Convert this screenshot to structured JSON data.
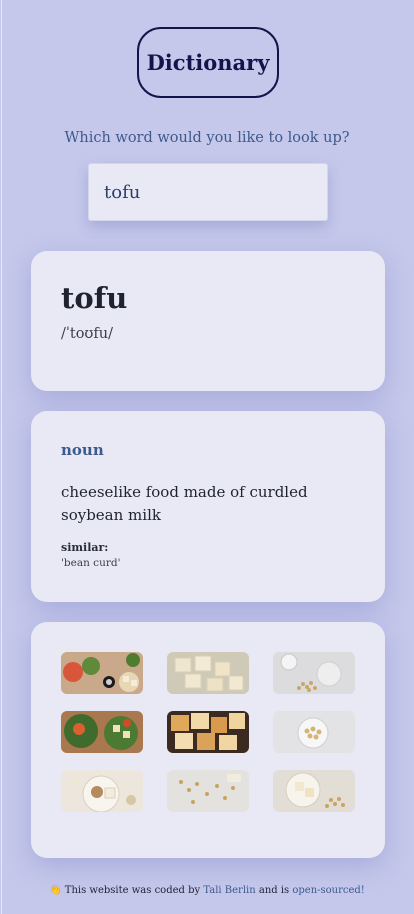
{
  "app": {
    "title": "Dictionary"
  },
  "search": {
    "prompt": "Which word would you like to look up?",
    "value": "tofu"
  },
  "word_card": {
    "word": "tofu",
    "phonetic": "/ˈtoʊfu/"
  },
  "definition_card": {
    "part_of_speech": "noun",
    "definition": "cheeselike food made of curdled soybean milk",
    "similar_label": "similar:",
    "similar_value": "'bean curd'"
  },
  "photos": [
    {
      "name": "photo-tofu-salad-spread",
      "subject": "tofu salad with greens"
    },
    {
      "name": "photo-tofu-cubes",
      "subject": "tofu cubes"
    },
    {
      "name": "photo-soybeans-milk",
      "subject": "soybeans and soy milk"
    },
    {
      "name": "photo-tofu-bowls",
      "subject": "tofu vegetable bowls"
    },
    {
      "name": "photo-fried-tofu",
      "subject": "fried tofu cubes"
    },
    {
      "name": "photo-soybean-bowl",
      "subject": "soybeans in bowl"
    },
    {
      "name": "photo-tofu-plate",
      "subject": "tofu on plate"
    },
    {
      "name": "photo-soybean-scatter",
      "subject": "scattered soybeans"
    },
    {
      "name": "photo-tofu-soybeans",
      "subject": "tofu with soybeans"
    }
  ],
  "footer": {
    "icon": "hand-icon",
    "prefix": "This website was coded by",
    "author": "Tali Berlin",
    "middle": "and is",
    "source_link": "open-sourced!"
  },
  "colors": {
    "background": "#c5c8eb",
    "card": "#e8e9f5",
    "accent": "#3d5a8c",
    "title": "#13154a"
  }
}
